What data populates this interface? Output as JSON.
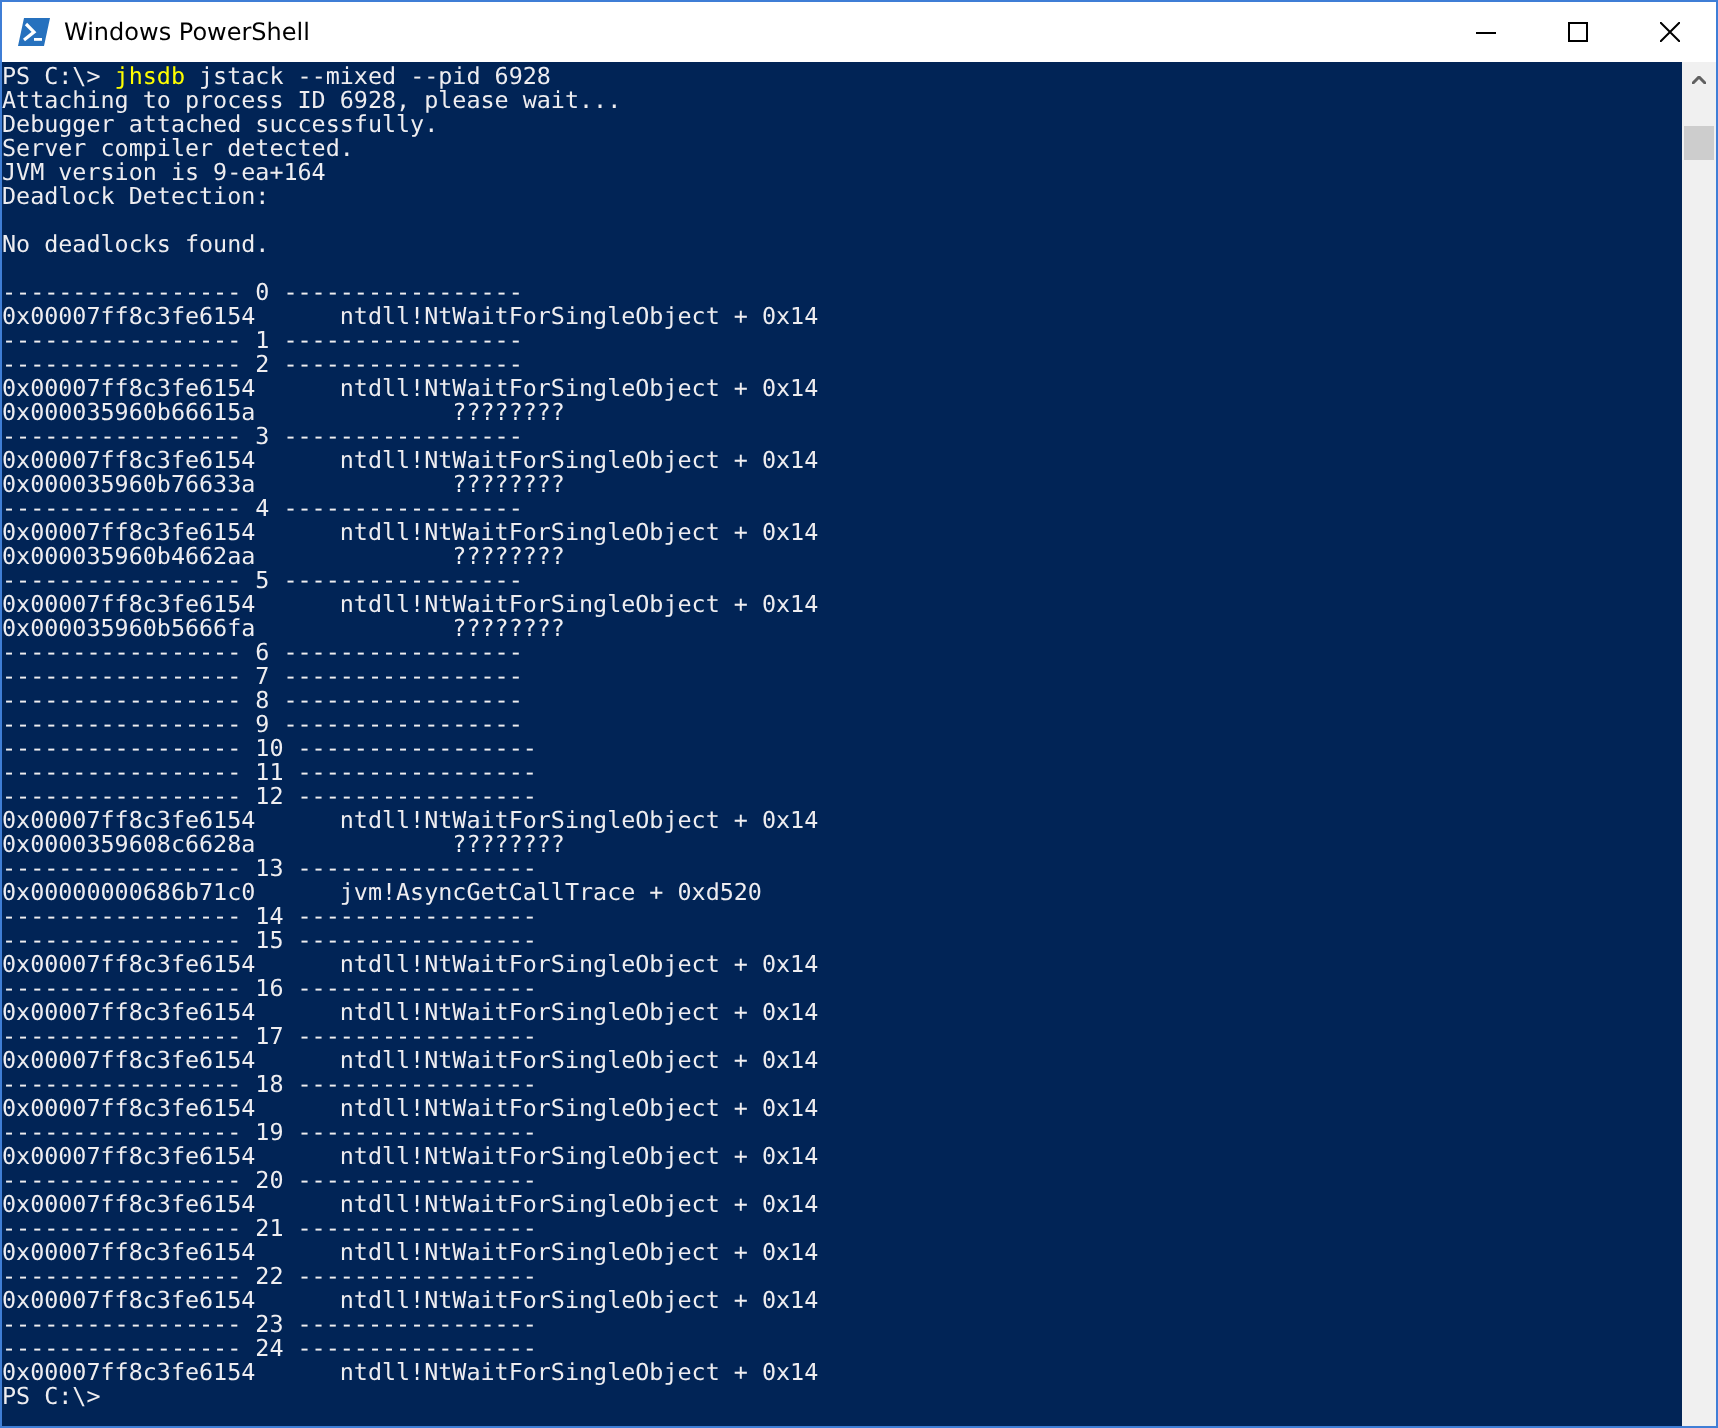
{
  "window": {
    "title": "Windows PowerShell"
  },
  "console": {
    "command": {
      "prompt": "PS C:\\> ",
      "program": "jhsdb",
      "arguments": " jstack --mixed --pid 6928"
    },
    "lines": [
      {
        "kind": "text",
        "text": "Attaching to process ID 6928, please wait..."
      },
      {
        "kind": "text",
        "text": "Debugger attached successfully."
      },
      {
        "kind": "text",
        "text": "Server compiler detected."
      },
      {
        "kind": "text",
        "text": "JVM version is 9-ea+164"
      },
      {
        "kind": "text",
        "text": "Deadlock Detection:"
      },
      {
        "kind": "blank"
      },
      {
        "kind": "text",
        "text": "No deadlocks found."
      },
      {
        "kind": "blank"
      },
      {
        "kind": "text",
        "text": "----------------- 0 -----------------"
      },
      {
        "kind": "text",
        "text": "0x00007ff8c3fe6154      ntdll!NtWaitForSingleObject + 0x14"
      },
      {
        "kind": "text",
        "text": "----------------- 1 -----------------"
      },
      {
        "kind": "text",
        "text": "----------------- 2 -----------------"
      },
      {
        "kind": "text",
        "text": "0x00007ff8c3fe6154      ntdll!NtWaitForSingleObject + 0x14"
      },
      {
        "kind": "text",
        "text": "0x000035960b66615a              ????????"
      },
      {
        "kind": "text",
        "text": "----------------- 3 -----------------"
      },
      {
        "kind": "text",
        "text": "0x00007ff8c3fe6154      ntdll!NtWaitForSingleObject + 0x14"
      },
      {
        "kind": "text",
        "text": "0x000035960b76633a              ????????"
      },
      {
        "kind": "text",
        "text": "----------------- 4 -----------------"
      },
      {
        "kind": "text",
        "text": "0x00007ff8c3fe6154      ntdll!NtWaitForSingleObject + 0x14"
      },
      {
        "kind": "text",
        "text": "0x000035960b4662aa              ????????"
      },
      {
        "kind": "text",
        "text": "----------------- 5 -----------------"
      },
      {
        "kind": "text",
        "text": "0x00007ff8c3fe6154      ntdll!NtWaitForSingleObject + 0x14"
      },
      {
        "kind": "text",
        "text": "0x000035960b5666fa              ????????"
      },
      {
        "kind": "text",
        "text": "----------------- 6 -----------------"
      },
      {
        "kind": "text",
        "text": "----------------- 7 -----------------"
      },
      {
        "kind": "text",
        "text": "----------------- 8 -----------------"
      },
      {
        "kind": "text",
        "text": "----------------- 9 -----------------"
      },
      {
        "kind": "text",
        "text": "----------------- 10 -----------------"
      },
      {
        "kind": "text",
        "text": "----------------- 11 -----------------"
      },
      {
        "kind": "text",
        "text": "----------------- 12 -----------------"
      },
      {
        "kind": "text",
        "text": "0x00007ff8c3fe6154      ntdll!NtWaitForSingleObject + 0x14"
      },
      {
        "kind": "text",
        "text": "0x0000359608c6628a              ????????"
      },
      {
        "kind": "text",
        "text": "----------------- 13 -----------------"
      },
      {
        "kind": "text",
        "text": "0x00000000686b71c0      jvm!AsyncGetCallTrace + 0xd520"
      },
      {
        "kind": "text",
        "text": "----------------- 14 -----------------"
      },
      {
        "kind": "text",
        "text": "----------------- 15 -----------------"
      },
      {
        "kind": "text",
        "text": "0x00007ff8c3fe6154      ntdll!NtWaitForSingleObject + 0x14"
      },
      {
        "kind": "text",
        "text": "----------------- 16 -----------------"
      },
      {
        "kind": "text",
        "text": "0x00007ff8c3fe6154      ntdll!NtWaitForSingleObject + 0x14"
      },
      {
        "kind": "text",
        "text": "----------------- 17 -----------------"
      },
      {
        "kind": "text",
        "text": "0x00007ff8c3fe6154      ntdll!NtWaitForSingleObject + 0x14"
      },
      {
        "kind": "text",
        "text": "----------------- 18 -----------------"
      },
      {
        "kind": "text",
        "text": "0x00007ff8c3fe6154      ntdll!NtWaitForSingleObject + 0x14"
      },
      {
        "kind": "text",
        "text": "----------------- 19 -----------------"
      },
      {
        "kind": "text",
        "text": "0x00007ff8c3fe6154      ntdll!NtWaitForSingleObject + 0x14"
      },
      {
        "kind": "text",
        "text": "----------------- 20 -----------------"
      },
      {
        "kind": "text",
        "text": "0x00007ff8c3fe6154      ntdll!NtWaitForSingleObject + 0x14"
      },
      {
        "kind": "text",
        "text": "----------------- 21 -----------------"
      },
      {
        "kind": "text",
        "text": "0x00007ff8c3fe6154      ntdll!NtWaitForSingleObject + 0x14"
      },
      {
        "kind": "text",
        "text": "----------------- 22 -----------------"
      },
      {
        "kind": "text",
        "text": "0x00007ff8c3fe6154      ntdll!NtWaitForSingleObject + 0x14"
      },
      {
        "kind": "text",
        "text": "----------------- 23 -----------------"
      },
      {
        "kind": "text",
        "text": "----------------- 24 -----------------"
      },
      {
        "kind": "text",
        "text": "0x00007ff8c3fe6154      ntdll!NtWaitForSingleObject + 0x14"
      },
      {
        "kind": "text",
        "text": "PS C:\\>"
      }
    ]
  }
}
